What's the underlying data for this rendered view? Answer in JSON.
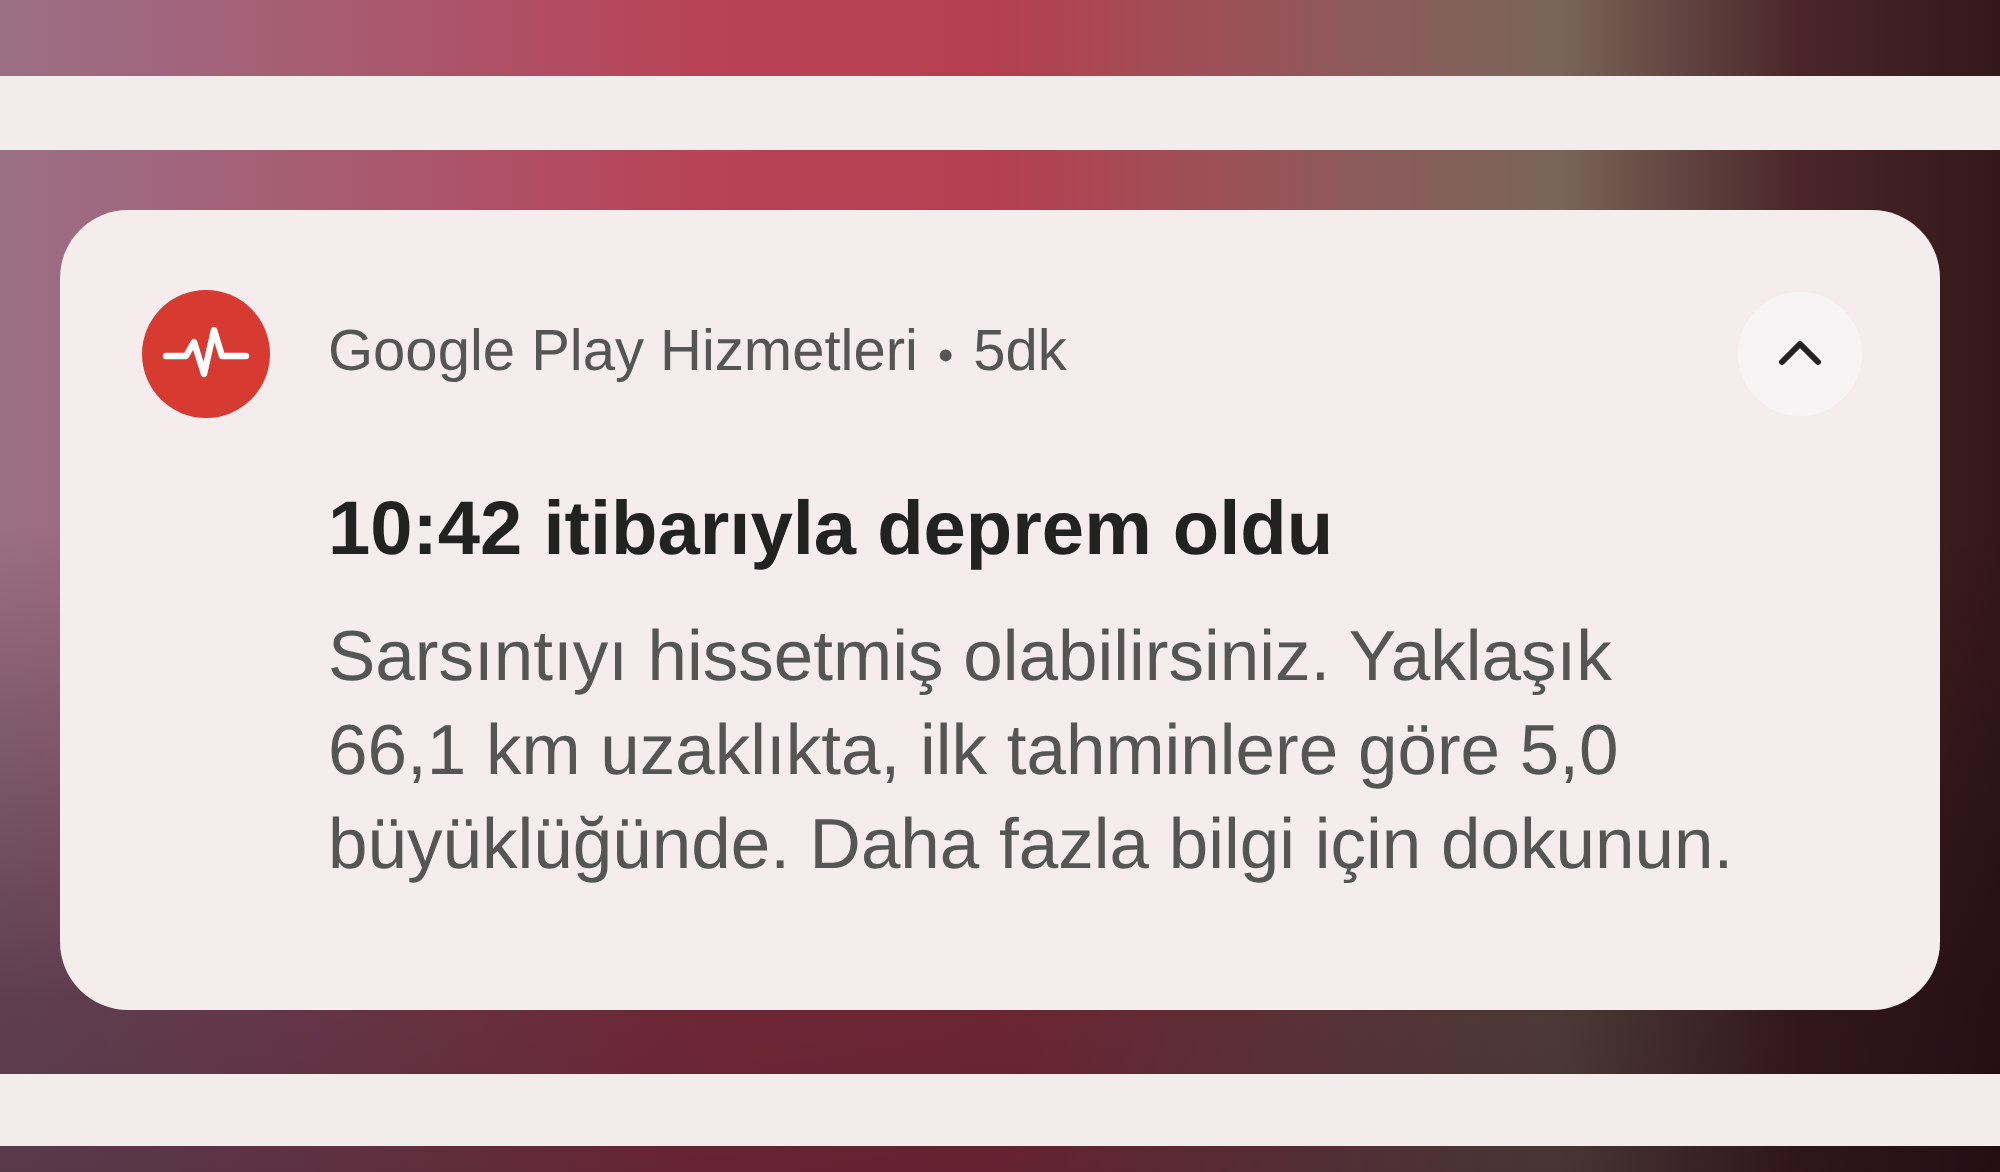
{
  "notification": {
    "app_name": "Google Play Hizmetleri",
    "separator": "•",
    "time": "5dk",
    "expanded": true,
    "title": "10:42 itibarıyla deprem oldu",
    "body": "Sarsıntıyı hissetmiş olabilirsiniz. Yaklaşık 66,1 km uzaklıkta, ilk tahminlere göre 5,0 büyüklüğünde. Daha fazla bilgi için dokunun."
  }
}
